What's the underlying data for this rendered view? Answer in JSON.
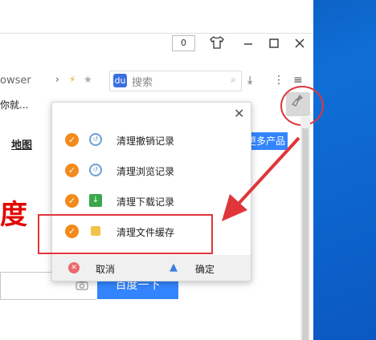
{
  "toolbar": {
    "counter": "0",
    "address_text": "owser",
    "search_placeholder": "搜索"
  },
  "bookmarks": {
    "item": "你就..."
  },
  "page": {
    "map_link": "地图",
    "more_products": "更多产品",
    "big_char": "度",
    "search_button": "百度一下"
  },
  "popup": {
    "items": [
      {
        "label": "清理撤销记录",
        "icon": "clock-icon",
        "checked": true
      },
      {
        "label": "清理浏览记录",
        "icon": "clock-icon",
        "checked": true
      },
      {
        "label": "清理下载记录",
        "icon": "download-icon",
        "checked": true
      },
      {
        "label": "清理文件缓存",
        "icon": "folder-icon",
        "checked": true
      }
    ],
    "cancel_label": "取消",
    "ok_label": "确定"
  },
  "colors": {
    "accent_orange": "#f28a1c",
    "annotation_red": "#e0353b",
    "baidu_blue": "#3385ff",
    "desktop_blue": "#0f6fd6"
  }
}
